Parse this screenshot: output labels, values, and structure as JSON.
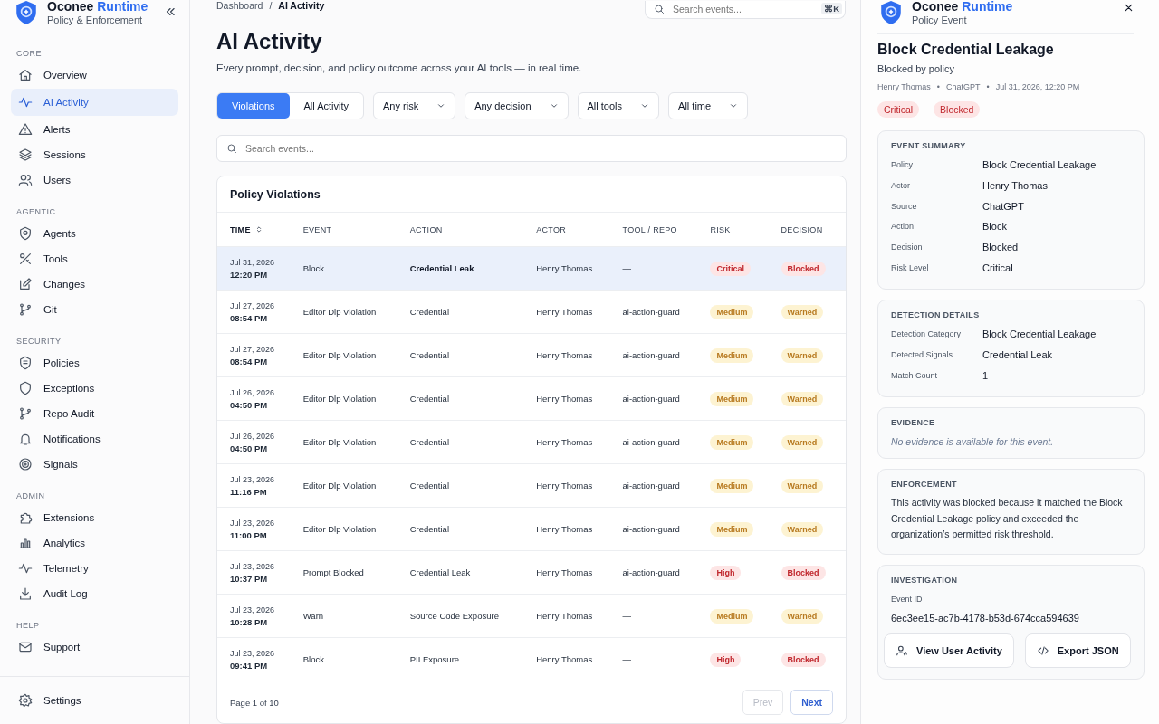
{
  "sidebar": {
    "brand": {
      "name": "Oconee",
      "accent": "Runtime",
      "subtitle": "Policy & Enforcement"
    },
    "sections": [
      {
        "label": "CORE",
        "items": [
          {
            "label": "Overview",
            "selected": false
          },
          {
            "label": "AI Activity",
            "selected": true
          },
          {
            "label": "Alerts",
            "selected": false
          },
          {
            "label": "Sessions",
            "selected": false
          },
          {
            "label": "Users",
            "selected": false
          }
        ]
      },
      {
        "label": "AGENTIC",
        "items": [
          {
            "label": "Agents",
            "selected": false
          },
          {
            "label": "Tools",
            "selected": false
          },
          {
            "label": "Changes",
            "selected": false
          },
          {
            "label": "Git",
            "selected": false
          }
        ]
      },
      {
        "label": "SECURITY",
        "items": [
          {
            "label": "Policies",
            "selected": false
          },
          {
            "label": "Exceptions",
            "selected": false
          },
          {
            "label": "Repo Audit",
            "selected": false
          },
          {
            "label": "Notifications",
            "selected": false
          },
          {
            "label": "Signals",
            "selected": false
          }
        ]
      },
      {
        "label": "ADMIN",
        "items": [
          {
            "label": "Extensions",
            "selected": false
          },
          {
            "label": "Analytics",
            "selected": false
          },
          {
            "label": "Telemetry",
            "selected": false
          },
          {
            "label": "Audit Log",
            "selected": false
          }
        ]
      },
      {
        "label": "HELP",
        "items": [
          {
            "label": "Support",
            "selected": false
          }
        ]
      }
    ],
    "footer_item": {
      "label": "Settings"
    }
  },
  "breadcrumb": [
    "Dashboard",
    "AI Activity"
  ],
  "breadcrumb_separator": "/",
  "top_search": {
    "placeholder": "Search events...",
    "shortcut": "⌘K"
  },
  "page": {
    "title": "AI Activity",
    "subtitle": "Every prompt, decision, and policy outcome across your AI tools — in real time."
  },
  "view_tabs": [
    {
      "label": "Violations",
      "selected": true
    },
    {
      "label": "All Activity",
      "selected": false
    }
  ],
  "filters": [
    "Any risk",
    "Any decision",
    "All tools",
    "All time"
  ],
  "search": {
    "placeholder": "Search events..."
  },
  "table": {
    "title": "Policy Violations",
    "columns": [
      "TIME",
      "EVENT",
      "ACTION",
      "ACTOR",
      "TOOL / REPO",
      "RISK",
      "DECISION"
    ],
    "rows": [
      {
        "date": "Jul 31, 2026",
        "time": "12:20 PM",
        "event": "Block",
        "action": "Credential Leak",
        "actor": "Henry Thomas",
        "tool": "—",
        "risk": {
          "text": "Critical",
          "kind": "danger"
        },
        "decision": {
          "text": "Blocked",
          "kind": "danger"
        },
        "selected": true
      },
      {
        "date": "Jul 27, 2026",
        "time": "08:54 PM",
        "event": "Editor Dlp Violation",
        "action": "Credential",
        "actor": "Henry Thomas",
        "tool": "ai-action-guard",
        "risk": {
          "text": "Medium",
          "kind": "warning"
        },
        "decision": {
          "text": "Warned",
          "kind": "warning"
        },
        "selected": false
      },
      {
        "date": "Jul 27, 2026",
        "time": "08:54 PM",
        "event": "Editor Dlp Violation",
        "action": "Credential",
        "actor": "Henry Thomas",
        "tool": "ai-action-guard",
        "risk": {
          "text": "Medium",
          "kind": "warning"
        },
        "decision": {
          "text": "Warned",
          "kind": "warning"
        },
        "selected": false
      },
      {
        "date": "Jul 26, 2026",
        "time": "04:50 PM",
        "event": "Editor Dlp Violation",
        "action": "Credential",
        "actor": "Henry Thomas",
        "tool": "ai-action-guard",
        "risk": {
          "text": "Medium",
          "kind": "warning"
        },
        "decision": {
          "text": "Warned",
          "kind": "warning"
        },
        "selected": false
      },
      {
        "date": "Jul 26, 2026",
        "time": "04:50 PM",
        "event": "Editor Dlp Violation",
        "action": "Credential",
        "actor": "Henry Thomas",
        "tool": "ai-action-guard",
        "risk": {
          "text": "Medium",
          "kind": "warning"
        },
        "decision": {
          "text": "Warned",
          "kind": "warning"
        },
        "selected": false
      },
      {
        "date": "Jul 23, 2026",
        "time": "11:16 PM",
        "event": "Editor Dlp Violation",
        "action": "Credential",
        "actor": "Henry Thomas",
        "tool": "ai-action-guard",
        "risk": {
          "text": "Medium",
          "kind": "warning"
        },
        "decision": {
          "text": "Warned",
          "kind": "warning"
        },
        "selected": false
      },
      {
        "date": "Jul 23, 2026",
        "time": "11:00 PM",
        "event": "Editor Dlp Violation",
        "action": "Credential",
        "actor": "Henry Thomas",
        "tool": "ai-action-guard",
        "risk": {
          "text": "Medium",
          "kind": "warning"
        },
        "decision": {
          "text": "Warned",
          "kind": "warning"
        },
        "selected": false
      },
      {
        "date": "Jul 23, 2026",
        "time": "10:37 PM",
        "event": "Prompt Blocked",
        "action": "Credential Leak",
        "actor": "Henry Thomas",
        "tool": "ai-action-guard",
        "risk": {
          "text": "High",
          "kind": "danger"
        },
        "decision": {
          "text": "Blocked",
          "kind": "danger"
        },
        "selected": false
      },
      {
        "date": "Jul 23, 2026",
        "time": "10:28 PM",
        "event": "Warn",
        "action": "Source Code Exposure",
        "actor": "Henry Thomas",
        "tool": "—",
        "risk": {
          "text": "Medium",
          "kind": "warning"
        },
        "decision": {
          "text": "Warned",
          "kind": "warning"
        },
        "selected": false
      },
      {
        "date": "Jul 23, 2026",
        "time": "09:41 PM",
        "event": "Block",
        "action": "PII Exposure",
        "actor": "Henry Thomas",
        "tool": "—",
        "risk": {
          "text": "High",
          "kind": "danger"
        },
        "decision": {
          "text": "Blocked",
          "kind": "danger"
        },
        "selected": false
      }
    ]
  },
  "pagination": {
    "page": "Page 1 of 10",
    "prev": {
      "label": "Prev",
      "disabled": true
    },
    "next": {
      "label": "Next",
      "disabled": false
    }
  },
  "detail": {
    "brand": {
      "name": "Oconee",
      "accent": "Runtime",
      "subtitle": "Policy Event"
    },
    "title": "Block Credential Leakage",
    "subtitle": "Blocked by policy",
    "meta": [
      "Henry Thomas",
      "ChatGPT",
      "Jul 31, 2026, 12:20 PM"
    ],
    "meta_separator": "•",
    "badges": [
      {
        "text": "Critical",
        "kind": "danger"
      },
      {
        "text": "Blocked",
        "kind": "danger"
      }
    ],
    "sections": [
      {
        "kind": "fields",
        "title": "EVENT SUMMARY",
        "fields": [
          {
            "label": "Policy",
            "value": "Block Credential Leakage"
          },
          {
            "label": "Actor",
            "value": "Henry Thomas"
          },
          {
            "label": "Source",
            "value": "ChatGPT"
          },
          {
            "label": "Action",
            "value": "Block"
          },
          {
            "label": "Decision",
            "value": "Blocked"
          },
          {
            "label": "Risk Level",
            "value": "Critical"
          }
        ]
      },
      {
        "kind": "fields",
        "title": "DETECTION DETAILS",
        "fields": [
          {
            "label": "Detection Category",
            "value": "Block Credential Leakage"
          },
          {
            "label": "Detected Signals",
            "value": "Credential Leak"
          },
          {
            "label": "Match Count",
            "value": "1"
          }
        ]
      },
      {
        "kind": "note",
        "title": "EVIDENCE",
        "text": "No evidence is available for this event."
      },
      {
        "kind": "paragraph",
        "title": "ENFORCEMENT",
        "text": "This activity was blocked because it matched the Block Credential Leakage policy and exceeded the organization’s permitted risk threshold."
      },
      {
        "kind": "id",
        "title": "INVESTIGATION",
        "label": "Event ID",
        "value": "6ec3ee15-ac7b-4178-b53d-674cca594639",
        "buttons": [
          "View User Activity",
          "Export JSON"
        ]
      }
    ]
  }
}
